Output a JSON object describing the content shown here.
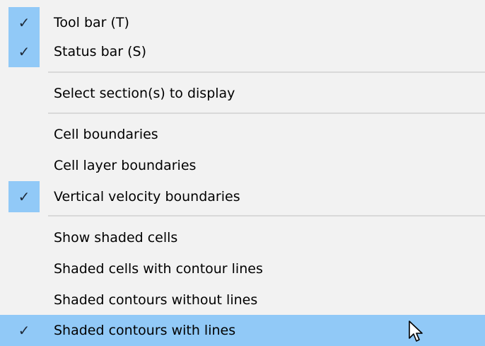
{
  "menu": {
    "items": [
      {
        "label": "Tool bar (T)",
        "checked": true,
        "check_glyph": "✓"
      },
      {
        "label": "Status bar (S)",
        "checked": true,
        "check_glyph": "✓"
      },
      {
        "label": "Select section(s) to display",
        "checked": false,
        "check_glyph": ""
      },
      {
        "label": "Cell boundaries",
        "checked": false,
        "check_glyph": ""
      },
      {
        "label": "Cell layer boundaries",
        "checked": false,
        "check_glyph": ""
      },
      {
        "label": "Vertical velocity boundaries",
        "checked": true,
        "check_glyph": "✓"
      },
      {
        "label": "Show shaded cells",
        "checked": false,
        "check_glyph": ""
      },
      {
        "label": "Shaded cells with contour lines",
        "checked": false,
        "check_glyph": ""
      },
      {
        "label": "Shaded contours without lines",
        "checked": false,
        "check_glyph": ""
      },
      {
        "label": "Shaded contours with lines",
        "checked": true,
        "check_glyph": "✓",
        "highlighted": true
      }
    ],
    "icons": {
      "check": "check-icon",
      "cursor": "mouse-pointer-icon"
    },
    "colors": {
      "background": "#f2f2f2",
      "highlight": "#91c9f7",
      "separator": "#d9d9d9",
      "text": "#000000"
    }
  }
}
